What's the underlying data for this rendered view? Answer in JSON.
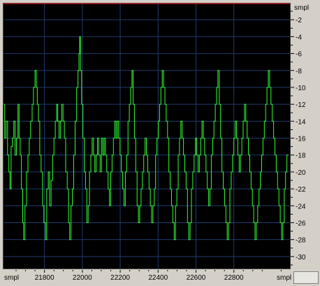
{
  "chart_data": {
    "type": "line",
    "xlabel": "smpl",
    "ylabel": "smpl",
    "xlim": [
      21580,
      23100
    ],
    "ylim": [
      0,
      -31.5
    ],
    "x_ticks": [
      21800,
      22000,
      22200,
      22400,
      22600,
      22800
    ],
    "y_ticks": [
      -2,
      -4,
      -6,
      -8,
      -10,
      -12,
      -14,
      -16,
      -18,
      -20,
      -22,
      -24,
      -26,
      -28,
      -30
    ],
    "x_start_label": "smpl",
    "x_end_label": "smpl",
    "y_top_label": "smpl",
    "grid": true,
    "reference_line": {
      "y": -0.1,
      "color": "#e02020"
    },
    "series": [
      {
        "color": "#33ff33",
        "points": [
          [
            21585,
            -12
          ],
          [
            21590,
            -16
          ],
          [
            21597,
            -14
          ],
          [
            21605,
            -18
          ],
          [
            21612,
            -20
          ],
          [
            21618,
            -22
          ],
          [
            21624,
            -17
          ],
          [
            21630,
            -16
          ],
          [
            21638,
            -14
          ],
          [
            21645,
            -18
          ],
          [
            21652,
            -16
          ],
          [
            21660,
            -12
          ],
          [
            21666,
            -16
          ],
          [
            21672,
            -18
          ],
          [
            21678,
            -22
          ],
          [
            21685,
            -26
          ],
          [
            21690,
            -28
          ],
          [
            21697,
            -24
          ],
          [
            21705,
            -20
          ],
          [
            21713,
            -18
          ],
          [
            21720,
            -16
          ],
          [
            21727,
            -14
          ],
          [
            21735,
            -12
          ],
          [
            21742,
            -10
          ],
          [
            21750,
            -8
          ],
          [
            21757,
            -10
          ],
          [
            21762,
            -12
          ],
          [
            21768,
            -14
          ],
          [
            21775,
            -18
          ],
          [
            21782,
            -20
          ],
          [
            21790,
            -24
          ],
          [
            21797,
            -26
          ],
          [
            21805,
            -28
          ],
          [
            21812,
            -22
          ],
          [
            21820,
            -20
          ],
          [
            21827,
            -24
          ],
          [
            21835,
            -21
          ],
          [
            21843,
            -18
          ],
          [
            21850,
            -16
          ],
          [
            21857,
            -14
          ],
          [
            21864,
            -12
          ],
          [
            21870,
            -14
          ],
          [
            21877,
            -16
          ],
          [
            21884,
            -14
          ],
          [
            21891,
            -12
          ],
          [
            21898,
            -14
          ],
          [
            21905,
            -16
          ],
          [
            21912,
            -20
          ],
          [
            21920,
            -22
          ],
          [
            21927,
            -26
          ],
          [
            21933,
            -28
          ],
          [
            21940,
            -24
          ],
          [
            21947,
            -22
          ],
          [
            21954,
            -18
          ],
          [
            21962,
            -14
          ],
          [
            21970,
            -10
          ],
          [
            21977,
            -8
          ],
          [
            21982,
            -6
          ],
          [
            21986,
            -4
          ],
          [
            21990,
            -8
          ],
          [
            21996,
            -12
          ],
          [
            22003,
            -16
          ],
          [
            22010,
            -20
          ],
          [
            22017,
            -22
          ],
          [
            22024,
            -26
          ],
          [
            22031,
            -24
          ],
          [
            22038,
            -20
          ],
          [
            22045,
            -18
          ],
          [
            22052,
            -16
          ],
          [
            22059,
            -18
          ],
          [
            22066,
            -20
          ],
          [
            22073,
            -18
          ],
          [
            22080,
            -16
          ],
          [
            22087,
            -18
          ],
          [
            22094,
            -20
          ],
          [
            22101,
            -16
          ],
          [
            22108,
            -18
          ],
          [
            22115,
            -16
          ],
          [
            22122,
            -18
          ],
          [
            22129,
            -20
          ],
          [
            22136,
            -22
          ],
          [
            22143,
            -24
          ],
          [
            22150,
            -20
          ],
          [
            22157,
            -18
          ],
          [
            22164,
            -16
          ],
          [
            22171,
            -14
          ],
          [
            22178,
            -16
          ],
          [
            22185,
            -14
          ],
          [
            22192,
            -16
          ],
          [
            22199,
            -18
          ],
          [
            22206,
            -20
          ],
          [
            22213,
            -22
          ],
          [
            22220,
            -24
          ],
          [
            22227,
            -20
          ],
          [
            22234,
            -18
          ],
          [
            22241,
            -14
          ],
          [
            22248,
            -12
          ],
          [
            22255,
            -10
          ],
          [
            22262,
            -8
          ],
          [
            22268,
            -12
          ],
          [
            22275,
            -16
          ],
          [
            22282,
            -20
          ],
          [
            22289,
            -24
          ],
          [
            22296,
            -26
          ],
          [
            22303,
            -24
          ],
          [
            22310,
            -22
          ],
          [
            22317,
            -20
          ],
          [
            22324,
            -18
          ],
          [
            22331,
            -16
          ],
          [
            22338,
            -18
          ],
          [
            22345,
            -20
          ],
          [
            22352,
            -22
          ],
          [
            22359,
            -24
          ],
          [
            22366,
            -26
          ],
          [
            22373,
            -24
          ],
          [
            22380,
            -22
          ],
          [
            22387,
            -18
          ],
          [
            22394,
            -16
          ],
          [
            22401,
            -14
          ],
          [
            22408,
            -12
          ],
          [
            22415,
            -10
          ],
          [
            22422,
            -8
          ],
          [
            22429,
            -10
          ],
          [
            22436,
            -12
          ],
          [
            22443,
            -14
          ],
          [
            22450,
            -16
          ],
          [
            22457,
            -20
          ],
          [
            22464,
            -22
          ],
          [
            22471,
            -24
          ],
          [
            22478,
            -26
          ],
          [
            22485,
            -28
          ],
          [
            22492,
            -24
          ],
          [
            22499,
            -22
          ],
          [
            22506,
            -18
          ],
          [
            22513,
            -16
          ],
          [
            22520,
            -14
          ],
          [
            22527,
            -16
          ],
          [
            22534,
            -18
          ],
          [
            22541,
            -20
          ],
          [
            22548,
            -22
          ],
          [
            22555,
            -26
          ],
          [
            22562,
            -28
          ],
          [
            22569,
            -26
          ],
          [
            22576,
            -22
          ],
          [
            22583,
            -20
          ],
          [
            22590,
            -18
          ],
          [
            22597,
            -16
          ],
          [
            22604,
            -18
          ],
          [
            22611,
            -20
          ],
          [
            22618,
            -18
          ],
          [
            22625,
            -16
          ],
          [
            22632,
            -14
          ],
          [
            22639,
            -16
          ],
          [
            22646,
            -18
          ],
          [
            22653,
            -20
          ],
          [
            22660,
            -22
          ],
          [
            22667,
            -24
          ],
          [
            22674,
            -22
          ],
          [
            22681,
            -18
          ],
          [
            22688,
            -16
          ],
          [
            22695,
            -14
          ],
          [
            22702,
            -12
          ],
          [
            22709,
            -10
          ],
          [
            22716,
            -8
          ],
          [
            22723,
            -12
          ],
          [
            22730,
            -16
          ],
          [
            22737,
            -20
          ],
          [
            22744,
            -22
          ],
          [
            22751,
            -24
          ],
          [
            22758,
            -26
          ],
          [
            22765,
            -28
          ],
          [
            22772,
            -26
          ],
          [
            22779,
            -22
          ],
          [
            22786,
            -20
          ],
          [
            22793,
            -18
          ],
          [
            22800,
            -16
          ],
          [
            22807,
            -14
          ],
          [
            22814,
            -16
          ],
          [
            22821,
            -18
          ],
          [
            22828,
            -20
          ],
          [
            22835,
            -18
          ],
          [
            22842,
            -16
          ],
          [
            22849,
            -14
          ],
          [
            22856,
            -12
          ],
          [
            22863,
            -14
          ],
          [
            22870,
            -16
          ],
          [
            22877,
            -18
          ],
          [
            22884,
            -20
          ],
          [
            22891,
            -22
          ],
          [
            22898,
            -24
          ],
          [
            22905,
            -26
          ],
          [
            22912,
            -28
          ],
          [
            22919,
            -26
          ],
          [
            22926,
            -24
          ],
          [
            22933,
            -22
          ],
          [
            22940,
            -20
          ],
          [
            22947,
            -18
          ],
          [
            22954,
            -16
          ],
          [
            22961,
            -14
          ],
          [
            22968,
            -12
          ],
          [
            22975,
            -10
          ],
          [
            22982,
            -8
          ],
          [
            22989,
            -10
          ],
          [
            22996,
            -12
          ],
          [
            23003,
            -14
          ],
          [
            23010,
            -16
          ],
          [
            23017,
            -18
          ],
          [
            23024,
            -20
          ],
          [
            23031,
            -22
          ],
          [
            23038,
            -24
          ],
          [
            23045,
            -26
          ],
          [
            23052,
            -28
          ],
          [
            23059,
            -26
          ],
          [
            23066,
            -22
          ],
          [
            23073,
            -20
          ],
          [
            23080,
            -18
          ],
          [
            23088,
            -18
          ]
        ]
      }
    ]
  }
}
